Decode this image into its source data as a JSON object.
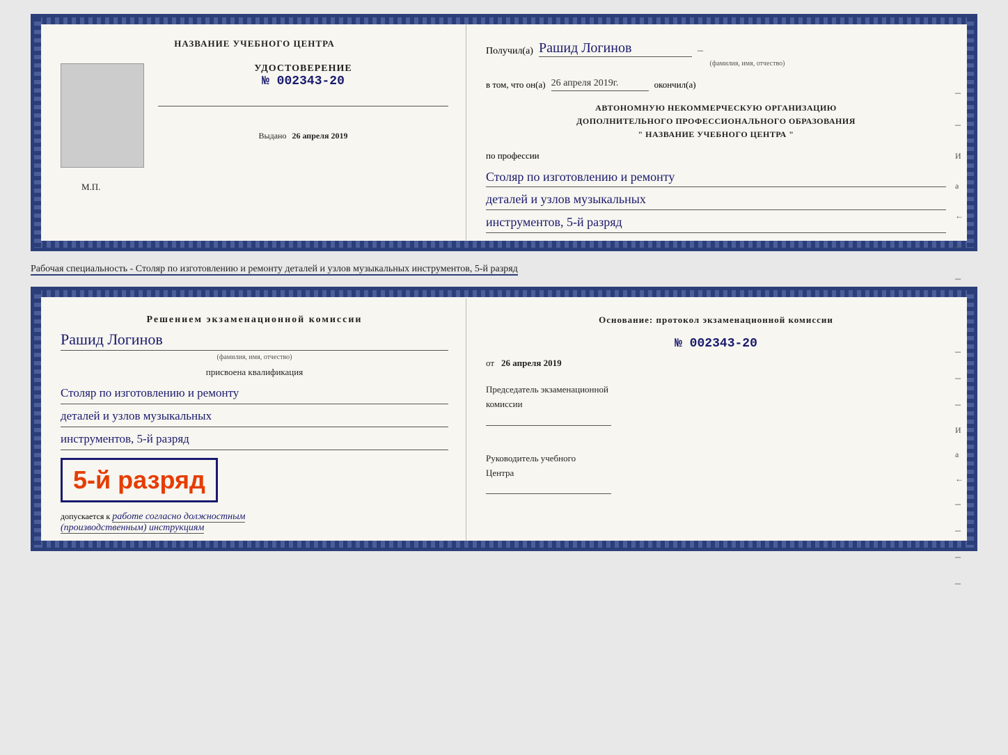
{
  "doc1": {
    "left": {
      "center_title": "НАЗВАНИЕ УЧЕБНОГО ЦЕНТРА",
      "udostoverenie_label": "УДОСТОВЕРЕНИЕ",
      "number_label": "№ 002343-20",
      "issued_label": "Выдано",
      "issued_date": "26 апреля 2019",
      "mp_label": "М.П."
    },
    "right": {
      "poluchil_label": "Получил(а)",
      "name_value": "Рашид Логинов",
      "fio_subtitle": "(фамилия, имя, отчество)",
      "vtom_label": "в том, что он(а)",
      "date_value": "26 апреля 2019г.",
      "okonchil_label": "окончил(а)",
      "org_line1": "АВТОНОМНУЮ НЕКОММЕРЧЕСКУЮ ОРГАНИЗАЦИЮ",
      "org_line2": "ДОПОЛНИТЕЛЬНОГО ПРОФЕССИОНАЛЬНОГО ОБРАЗОВАНИЯ",
      "org_name": "\" НАЗВАНИЕ УЧЕБНОГО ЦЕНТРА \"",
      "po_professii_label": "по профессии",
      "profession_line1": "Столяр по изготовлению и ремонту",
      "profession_line2": "деталей и узлов музыкальных",
      "profession_line3": "инструментов, 5-й разряд"
    }
  },
  "separator": {
    "text": "Рабочая специальность - Столяр по изготовлению и ремонту деталей и узлов музыкальных инструментов, 5-й разряд"
  },
  "doc2": {
    "left": {
      "resheniem_line1": "Решением экзаменационной комиссии",
      "fio_value": "Рашид Логинов",
      "fio_subtitle": "(фамилия, имя, отчество)",
      "prisvoena_label": "присвоена квалификация",
      "qualification_line1": "Столяр по изготовлению и ремонту",
      "qualification_line2": "деталей и узлов музыкальных",
      "qualification_line3": "инструментов, 5-й разряд",
      "razryad_text": "5-й разряд",
      "dopuskaetsya_label": "допускается к",
      "dopuskaetsya_value": "работе согласно должностным",
      "dopuskaetsya_value2": "(производственным) инструкциям"
    },
    "right": {
      "osnovanie_label": "Основание: протокол экзаменационной комиссии",
      "number_value": "№ 002343-20",
      "ot_label": "от",
      "ot_date": "26 апреля 2019",
      "predsedatel_line1": "Председатель экзаменационной",
      "predsedatel_line2": "комиссии",
      "rukovoditel_line1": "Руководитель учебного",
      "rukovoditel_line2": "Центра"
    }
  },
  "side_marks": {
    "letters": [
      "И",
      "а",
      "←"
    ]
  }
}
